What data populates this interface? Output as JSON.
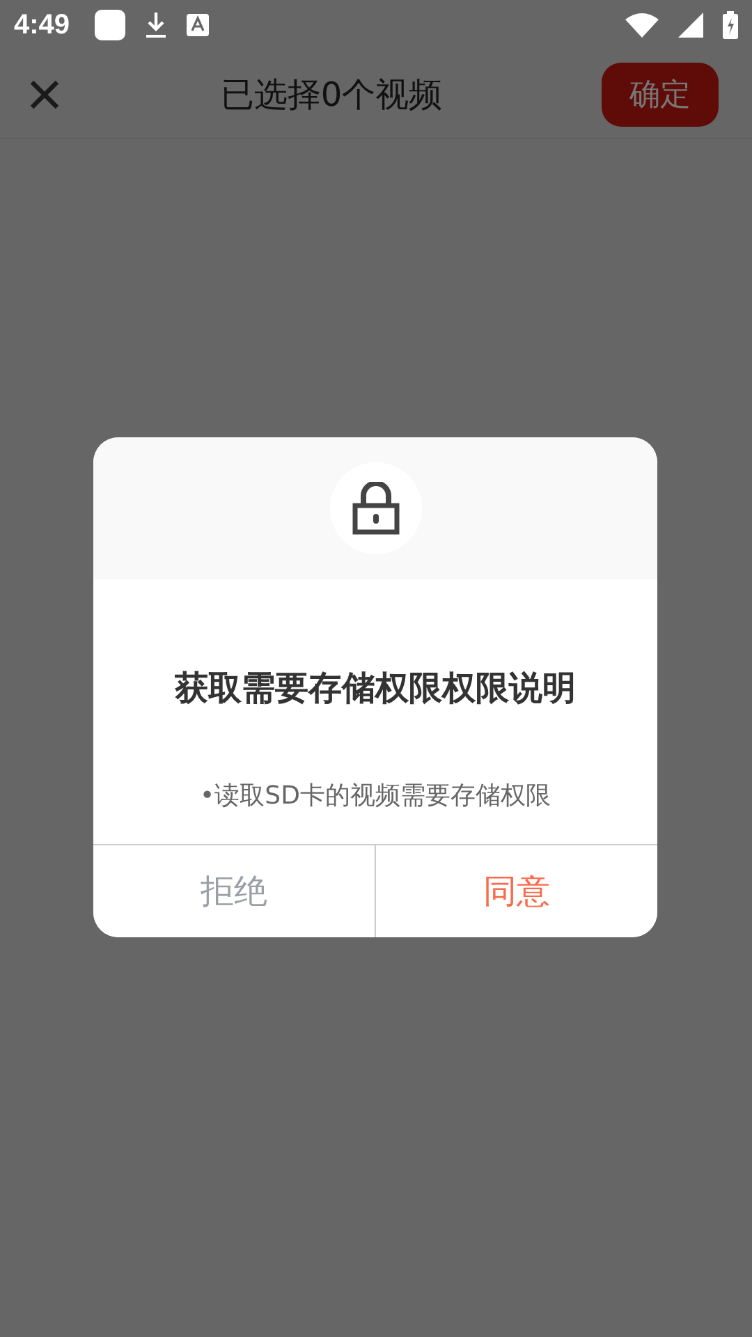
{
  "status_bar": {
    "time": "4:49"
  },
  "app_bar": {
    "title": "已选择0个视频",
    "confirm": "确定"
  },
  "dialog": {
    "title": "获取需要存储权限权限说明",
    "message": "•读取SD卡的视频需要存储权限",
    "buttons": [
      {
        "label": "拒绝",
        "kind": "negative"
      },
      {
        "label": "同意",
        "kind": "positive"
      }
    ]
  }
}
